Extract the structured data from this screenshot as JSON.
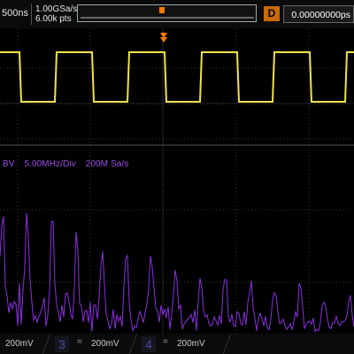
{
  "topbar": {
    "timebase": "500ns",
    "sample_rate": "1.00GSa/s",
    "mem_depth": "6.00k pts",
    "trigger_letter": "D",
    "delay": "0.00000000ps"
  },
  "fft": {
    "level": "BV",
    "span": "5.00MHz/Div",
    "rate": "200M Sa/s"
  },
  "channels": [
    {
      "number": "",
      "scale": "200mV"
    },
    {
      "number": "3",
      "scale": "200mV"
    },
    {
      "number": "4",
      "scale": "200mV"
    }
  ],
  "colors": {
    "ch1": "#f2e24a",
    "math": "#8b2fe0",
    "trigger": "#ff7a00"
  }
}
